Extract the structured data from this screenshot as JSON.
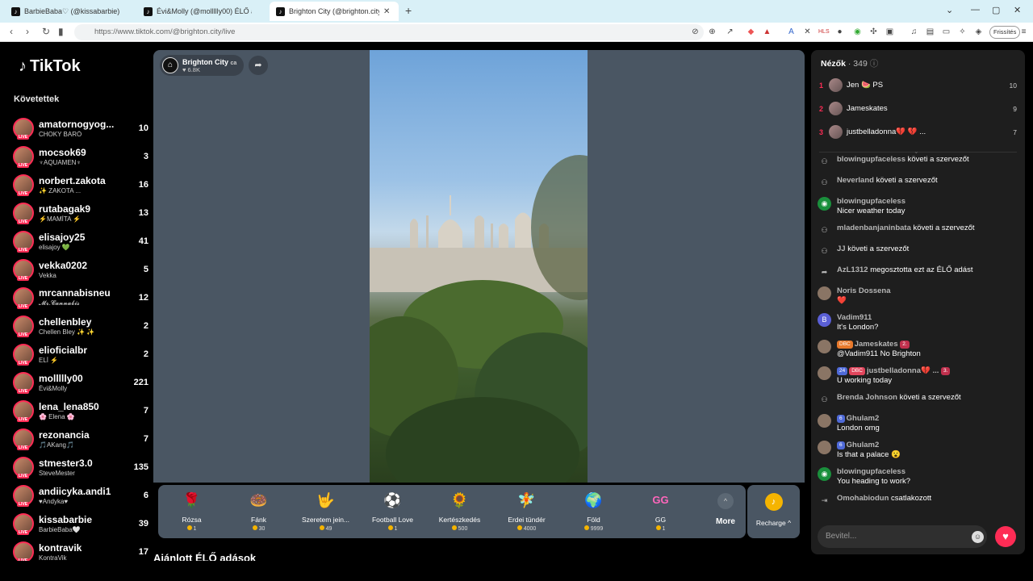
{
  "browser": {
    "tabs": [
      {
        "title": "BarbieBaba♡ (@kissabarbie) ÉL"
      },
      {
        "title": "Évi&Molly (@mollllly00) ÉLŐ adás"
      },
      {
        "title": "Brighton City (@brighton.city)"
      }
    ],
    "new_tab": "+",
    "url": "https://www.tiktok.com/@brighton.city/live",
    "refresh_label": "Frissítés"
  },
  "sidebar": {
    "logo": "TikTok",
    "following_title": "Követettek",
    "items": [
      {
        "name": "amatornogyog...",
        "sub": "CHOKY BARÓ",
        "count": "10"
      },
      {
        "name": "mocsok69",
        "sub": "♆AQUAMEN♆",
        "count": "3"
      },
      {
        "name": "norbert.zakota",
        "sub": "✨ ZAKOTA ...",
        "count": "16"
      },
      {
        "name": "rutabagak9",
        "sub": "⚡MAMÍTA ⚡",
        "count": "13"
      },
      {
        "name": "elisajoy25",
        "sub": "elisajoy 💚",
        "count": "41"
      },
      {
        "name": "vekka0202",
        "sub": "Vekka",
        "count": "5"
      },
      {
        "name": "mrcannabisneu",
        "sub": "𝓜𝓻.𝓒𝓪𝓷𝓷𝓪𝓫𝓲𝓼",
        "count": "12"
      },
      {
        "name": "chellenbley",
        "sub": "Chellen Bley ✨ ✨",
        "count": "2"
      },
      {
        "name": "elioficialbr",
        "sub": "ELÍ ⚡",
        "count": "2"
      },
      {
        "name": "mollllly00",
        "sub": "Évi&Molly",
        "count": "221"
      },
      {
        "name": "lena_lena850",
        "sub": "🌸 Elena 🌸",
        "count": "7"
      },
      {
        "name": "rezonancia",
        "sub": "🎵AKang🎵",
        "count": "7"
      },
      {
        "name": "stmester3.0",
        "sub": "SteveMester",
        "count": "135"
      },
      {
        "name": "andiicyka.andi1",
        "sub": "♥Andyka♥",
        "count": "6"
      },
      {
        "name": "kissabarbie",
        "sub": "BarbieBaba🤍",
        "count": "39"
      },
      {
        "name": "kontravik",
        "sub": "KontraVik",
        "count": "17"
      }
    ]
  },
  "stream": {
    "host_name": "Brighton City",
    "host_badge": "ca",
    "likes": "6.8K"
  },
  "gifts": [
    {
      "name": "Rózsa",
      "price": "1",
      "icon": "🌹",
      "color": "#e33"
    },
    {
      "name": "Fánk",
      "price": "30",
      "icon": "🍩",
      "color": "#f8a"
    },
    {
      "name": "Szeretem jein...",
      "price": "49",
      "icon": "🤟",
      "color": "#c96"
    },
    {
      "name": "Football Love",
      "price": "1",
      "icon": "⚽",
      "color": "#c33"
    },
    {
      "name": "Kertészkedés",
      "price": "500",
      "icon": "🌻",
      "color": "#ea3"
    },
    {
      "name": "Erdei tündér",
      "price": "4000",
      "icon": "🧚",
      "color": "#7a5"
    },
    {
      "name": "Föld",
      "price": "9999",
      "icon": "🌍",
      "color": "#586"
    },
    {
      "name": "GG",
      "price": "1",
      "icon": "GG",
      "color": "#f6b"
    }
  ],
  "more_label": "More",
  "recharge_label": "Recharge",
  "recommended_title": "Ajánlott ÉLŐ adások",
  "viewers": {
    "title": "Nézők",
    "count": "· 349",
    "top": [
      {
        "rank": "1",
        "name": "Jen 🍉 PS",
        "score": "10"
      },
      {
        "rank": "2",
        "name": "Jameskates",
        "score": "9"
      },
      {
        "rank": "3",
        "name": "justbelladonna💔 💔 ...",
        "score": "7"
      }
    ]
  },
  "chat": [
    {
      "user": "blowingupfaceless",
      "action": "követi a szervezőt",
      "icon": "person"
    },
    {
      "user": "Neverland",
      "action": "követi a szervezőt",
      "icon": "person"
    },
    {
      "user": "blowingupfaceless",
      "text": "Nicer weather today",
      "icon": "green"
    },
    {
      "user": "mladenbanjaninbata",
      "action": "követi a szervezőt",
      "icon": "person"
    },
    {
      "user": "JJ",
      "action": "követi a szervezőt",
      "icon": "person"
    },
    {
      "user": "AzL1312",
      "action": "megosztotta ezt az ÉLŐ adást",
      "icon": "share"
    },
    {
      "user": "Noris Dossena",
      "text": "❤️",
      "icon": "photo"
    },
    {
      "user": "Vadim911",
      "text": "It's London?",
      "icon": "letter"
    },
    {
      "user": "Jameskates",
      "text": "@Vadim911 No Brighton",
      "badge": "DBC",
      "badge2": "2.",
      "icon": "photo"
    },
    {
      "user": "justbelladonna💔 ...",
      "text": "U working today",
      "badge": "24",
      "badge3": "DBC",
      "badge2": "3.",
      "icon": "photo"
    },
    {
      "user": "Brenda Johnson",
      "action": "követi a szervezőt",
      "icon": "person"
    },
    {
      "user": "Ghulam2",
      "text": "London omg",
      "badge": "6",
      "icon": "photo"
    },
    {
      "user": "Ghulam2",
      "text": "Is that a palace 😮",
      "badge": "6",
      "icon": "photo"
    },
    {
      "user": "blowingupfaceless",
      "text": "You heading to work?",
      "icon": "green"
    },
    {
      "user": "Omohabiodun",
      "action": "csatlakozott",
      "icon": "join"
    }
  ],
  "chat_input_placeholder": "Bevitel..."
}
